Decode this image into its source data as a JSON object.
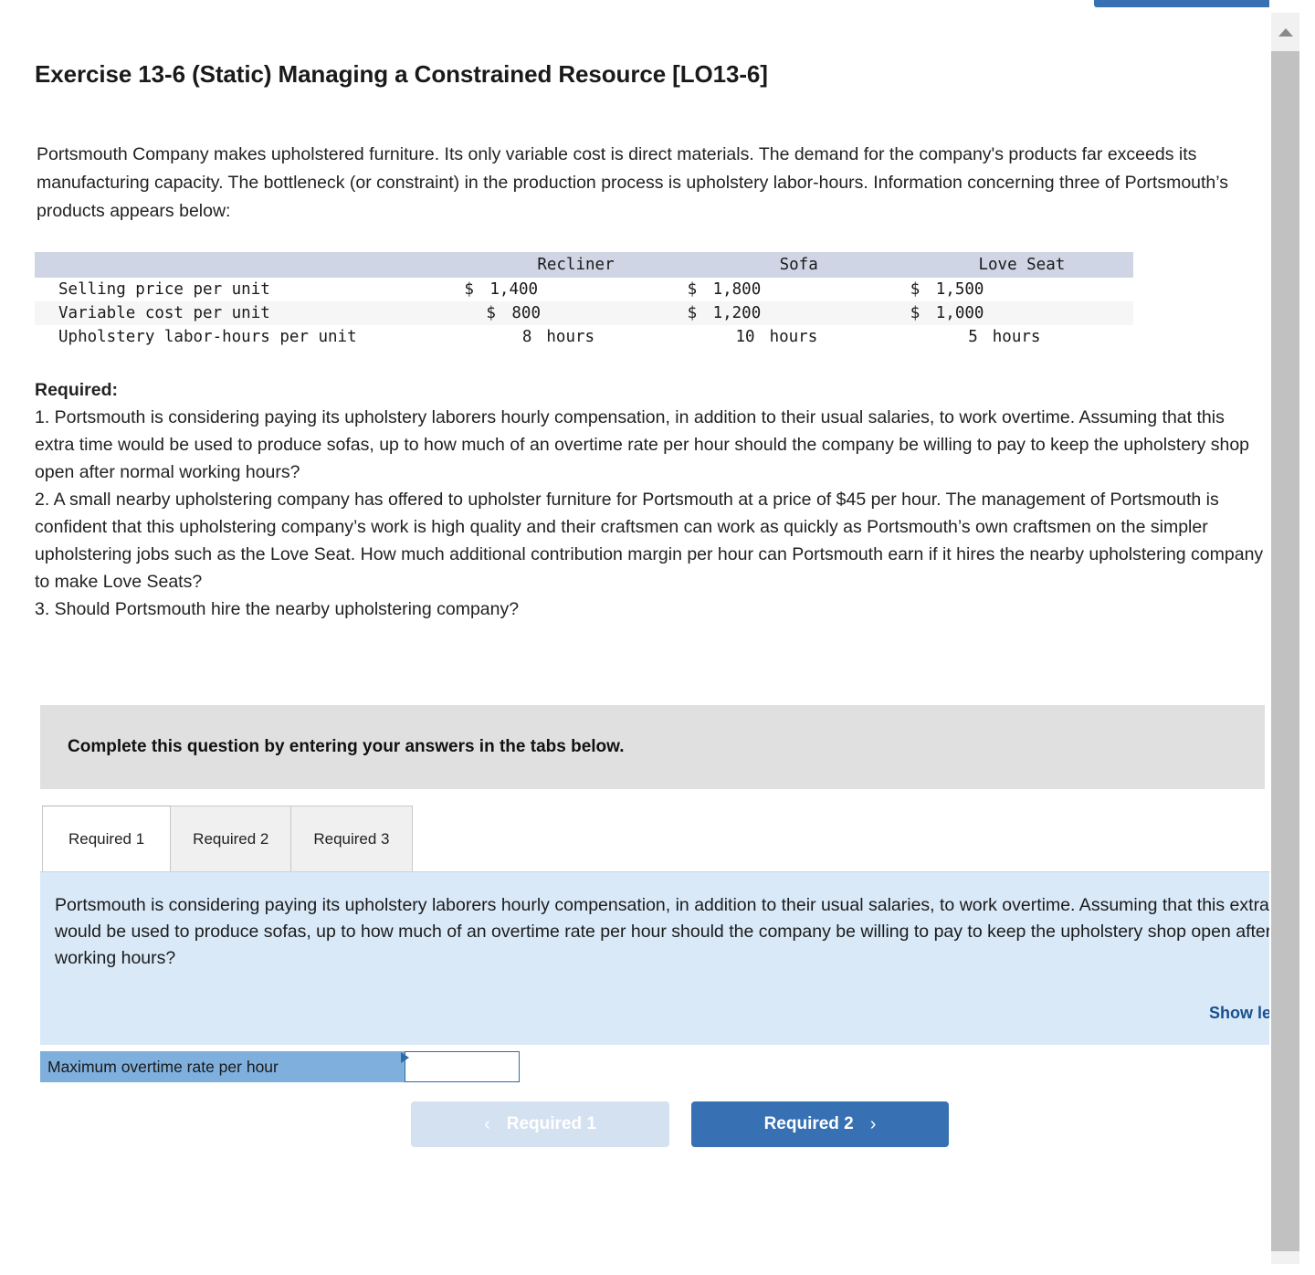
{
  "title": "Exercise 13-6 (Static) Managing a Constrained Resource [LO13-6]",
  "intro": "Portsmouth Company makes upholstered furniture. Its only variable cost is direct materials. The demand for the company's products far exceeds its manufacturing capacity. The bottleneck (or constraint) in the production process is upholstery labor-hours. Information concerning three of Portsmouth’s products appears below:",
  "table": {
    "columns": [
      "",
      "Recliner",
      "Sofa",
      "Love Seat"
    ],
    "rows": [
      {
        "label": "Selling price per unit",
        "values": [
          {
            "symbol": "$",
            "amount": "1,400"
          },
          {
            "symbol": "$",
            "amount": "1,800"
          },
          {
            "symbol": "$",
            "amount": "1,500"
          }
        ]
      },
      {
        "label": "Variable cost per unit",
        "values": [
          {
            "symbol": "$",
            "amount": "800"
          },
          {
            "symbol": "$",
            "amount": "1,200"
          },
          {
            "symbol": "$",
            "amount": "1,000"
          }
        ]
      },
      {
        "label": "Upholstery labor-hours per unit",
        "values": [
          {
            "number": "8",
            "unit": "hours"
          },
          {
            "number": "10",
            "unit": "hours"
          },
          {
            "number": "5",
            "unit": "hours"
          }
        ]
      }
    ]
  },
  "required": {
    "heading": "Required:",
    "items": [
      "1. Portsmouth is considering paying its upholstery laborers hourly compensation, in addition to their usual salaries, to work overtime. Assuming that this extra time would be used to produce sofas, up to how much of an overtime rate per hour should the company be willing to pay to keep the upholstery shop open after normal working hours?",
      "2. A small nearby upholstering company has offered to upholster furniture for Portsmouth at a price of $45 per hour. The management of Portsmouth is confident that this upholstering company’s work is high quality and their craftsmen can work as quickly as Portsmouth’s own craftsmen on the simpler upholstering jobs such as the Love Seat. How much additional contribution margin per hour can Portsmouth earn if it hires the nearby upholstering company to make Love Seats?",
      "3. Should Portsmouth hire the nearby upholstering company?"
    ]
  },
  "instruction_banner": "Complete this question by entering your answers in the tabs below.",
  "tabs": [
    {
      "label": "Required 1",
      "active": true
    },
    {
      "label": "Required 2",
      "active": false
    },
    {
      "label": "Required 3",
      "active": false
    }
  ],
  "question_panel": {
    "text": "Portsmouth is considering paying its upholstery laborers hourly compensation, in addition to their usual salaries, to work overtime. Assuming that this extra time would be used to produce sofas, up to how much of an overtime rate per hour should the company be willing to pay to keep the upholstery shop open after normal working hours?",
    "show_less_label": "Show less"
  },
  "answer_row": {
    "label": "Maximum overtime rate per hour",
    "value": "",
    "placeholder": ""
  },
  "nav": {
    "prev_label": "Required 1",
    "prev_chevron": "‹",
    "next_label": "Required 2",
    "next_chevron": "›"
  },
  "colors": {
    "accent_blue": "#3771B3",
    "panel_blue": "#D9E9F8",
    "label_blue": "#7FAFDC",
    "table_header": "#CFD5E4",
    "banner_gray": "#E0E0E0",
    "link_blue": "#19508F"
  }
}
